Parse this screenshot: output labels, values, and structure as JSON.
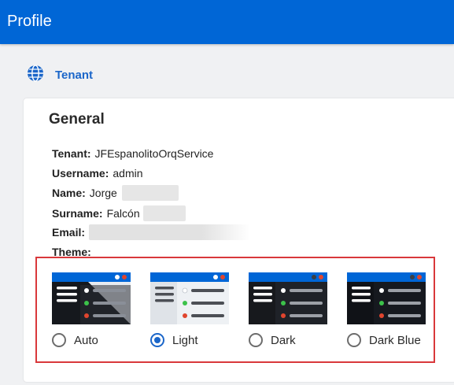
{
  "header": {
    "title": "Profile"
  },
  "tenant_link": {
    "label": "Tenant",
    "icon": "globe-icon",
    "color": "#1b66c9"
  },
  "card": {
    "title": "General"
  },
  "fields": {
    "tenant": {
      "key": "Tenant:",
      "value": "JFEspanolitoOrqService"
    },
    "username": {
      "key": "Username:",
      "value": "admin"
    },
    "name": {
      "key": "Name:",
      "value": "Jorge"
    },
    "surname": {
      "key": "Surname:",
      "value": "Falcón"
    },
    "email": {
      "key": "Email:",
      "value": ""
    },
    "theme": {
      "key": "Theme:"
    }
  },
  "themes": {
    "selected": "Light",
    "options": [
      {
        "label": "Auto",
        "selected": false
      },
      {
        "label": "Light",
        "selected": true
      },
      {
        "label": "Dark",
        "selected": false
      },
      {
        "label": "Dark Blue",
        "selected": false
      }
    ]
  },
  "colors": {
    "header_bg": "#0066d6",
    "accent": "#1b66c9",
    "highlight_border": "#d9383b",
    "status_white": "#ffffff",
    "status_green": "#3cc24a",
    "status_red": "#e0452e"
  }
}
